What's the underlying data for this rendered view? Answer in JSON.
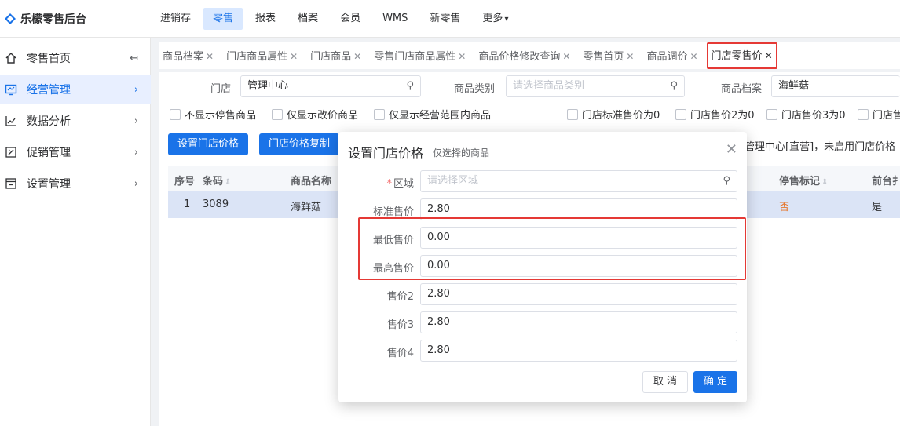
{
  "app": {
    "title": "乐檬零售后台"
  },
  "topnav": [
    {
      "label": "进销存"
    },
    {
      "label": "零售",
      "active": true
    },
    {
      "label": "报表"
    },
    {
      "label": "档案"
    },
    {
      "label": "会员"
    },
    {
      "label": "WMS"
    },
    {
      "label": "新零售"
    },
    {
      "label": "更多"
    }
  ],
  "sidebar": {
    "collapse_icon": "collapse-left-icon",
    "items": [
      {
        "label": "零售首页",
        "icon": "home-icon"
      },
      {
        "label": "经营管理",
        "icon": "monitor-icon",
        "active": true
      },
      {
        "label": "数据分析",
        "icon": "chart-line-icon"
      },
      {
        "label": "促销管理",
        "icon": "promo-icon"
      },
      {
        "label": "设置管理",
        "icon": "settings-box-icon"
      }
    ]
  },
  "tabs": [
    {
      "label": "商品档案"
    },
    {
      "label": "门店商品属性"
    },
    {
      "label": "门店商品"
    },
    {
      "label": "零售门店商品属性"
    },
    {
      "label": "商品价格修改查询"
    },
    {
      "label": "零售首页"
    },
    {
      "label": "商品调价"
    },
    {
      "label": "门店零售价",
      "active": true
    }
  ],
  "filters": {
    "store_label": "门店",
    "store_value": "管理中心",
    "category_label": "商品类别",
    "category_placeholder": "请选择商品类别",
    "archive_label": "商品档案",
    "archive_value": "海鲜菇"
  },
  "checkboxes": [
    "不显示停售商品",
    "仅显示改价商品",
    "仅显示经营范围内商品",
    "门店标准售价为0",
    "门店售价2为0",
    "门店售价3为0",
    "门店售"
  ],
  "actions": {
    "set_price": "设置门店价格",
    "copy_price": "门店价格复制"
  },
  "notice": "管理中心[直营]，未启用门店价格",
  "table": {
    "headers": [
      "序号",
      "条码",
      "商品名称",
      "停售标记",
      "前台扌"
    ],
    "rows": [
      {
        "index": "1",
        "barcode": "3089",
        "name": "海鲜菇",
        "stop": "否",
        "front": "是"
      }
    ]
  },
  "modal": {
    "title": "设置门店价格",
    "subtitle": "仅选择的商品",
    "fields": [
      {
        "label": "区域",
        "required": true,
        "placeholder": "请选择区域",
        "value": ""
      },
      {
        "label": "标准售价",
        "value": "2.80"
      },
      {
        "label": "最低售价",
        "value": "0.00"
      },
      {
        "label": "最高售价",
        "value": "0.00"
      },
      {
        "label": "售价2",
        "value": "2.80"
      },
      {
        "label": "售价3",
        "value": "2.80"
      },
      {
        "label": "售价4",
        "value": "2.80"
      }
    ],
    "cancel": "取 消",
    "confirm": "确 定"
  },
  "colors": {
    "accent": "#1a73e8",
    "highlight": "#e53935",
    "warning": "#e6772e"
  }
}
